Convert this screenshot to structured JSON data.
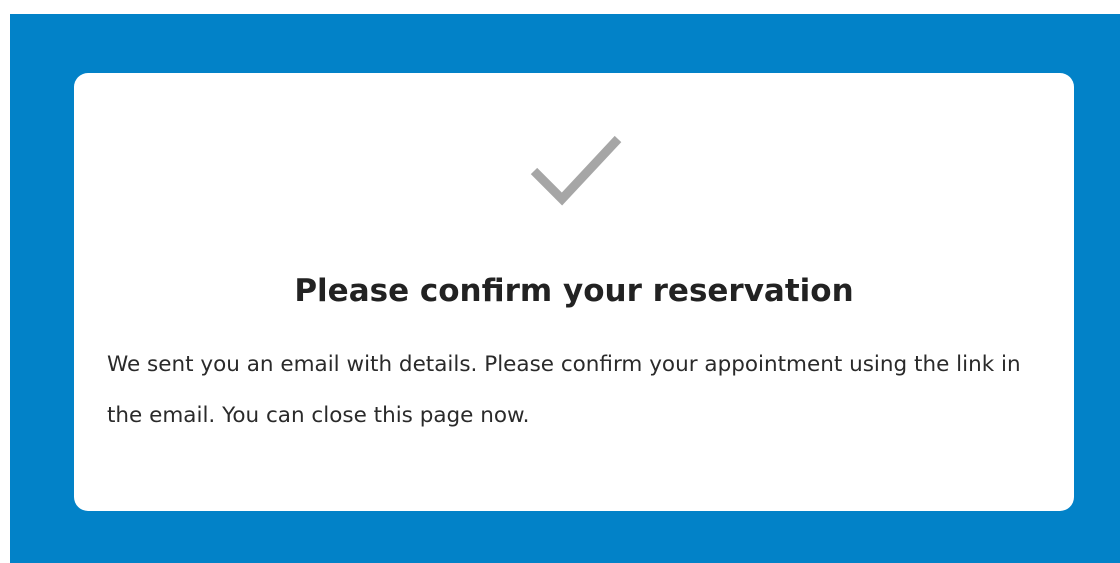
{
  "confirmation": {
    "icon": "checkmark-icon",
    "title": "Please confirm your reservation",
    "message": "We sent you an email with details. Please confirm your appointment using the link in the email. You can close this page now."
  },
  "colors": {
    "background": "#0282c8",
    "card": "#ffffff",
    "icon": "#a6a6a6",
    "text": "#222222"
  }
}
